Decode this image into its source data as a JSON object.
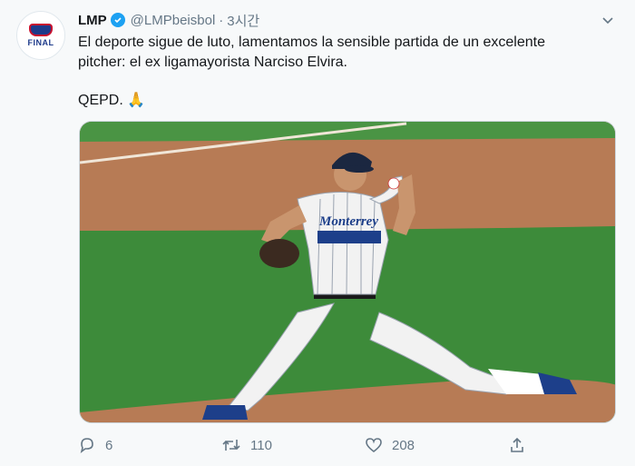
{
  "account": {
    "avatar_text": "FINAL",
    "display_name": "LMP",
    "handle": "@LMPbeisbol",
    "separator": "·",
    "time": "3시간"
  },
  "tweet": {
    "text_line1": "El deporte sigue de luto, lamentamos la sensible partida de un excelente",
    "text_line2": "pitcher: el ex ligamayorista Narciso Elvira.",
    "text_line3": "QEPD. 🙏"
  },
  "photo": {
    "jersey_text": "Monterrey",
    "colors": {
      "dirt": "#b77b55",
      "grass": "#3d8b3a",
      "jersey": "#f2f2f2",
      "pinstripe": "#9aa3b0"
    }
  },
  "actions": {
    "reply_count": "6",
    "retweet_count": "110",
    "like_count": "208"
  },
  "icons": [
    "verified-badge-icon",
    "caret-down-icon",
    "reply-icon",
    "retweet-icon",
    "like-icon",
    "share-icon"
  ],
  "colors": {
    "accent": "#1da1f2",
    "muted": "#657786",
    "text": "#14171a",
    "background": "#f7f9fa"
  }
}
